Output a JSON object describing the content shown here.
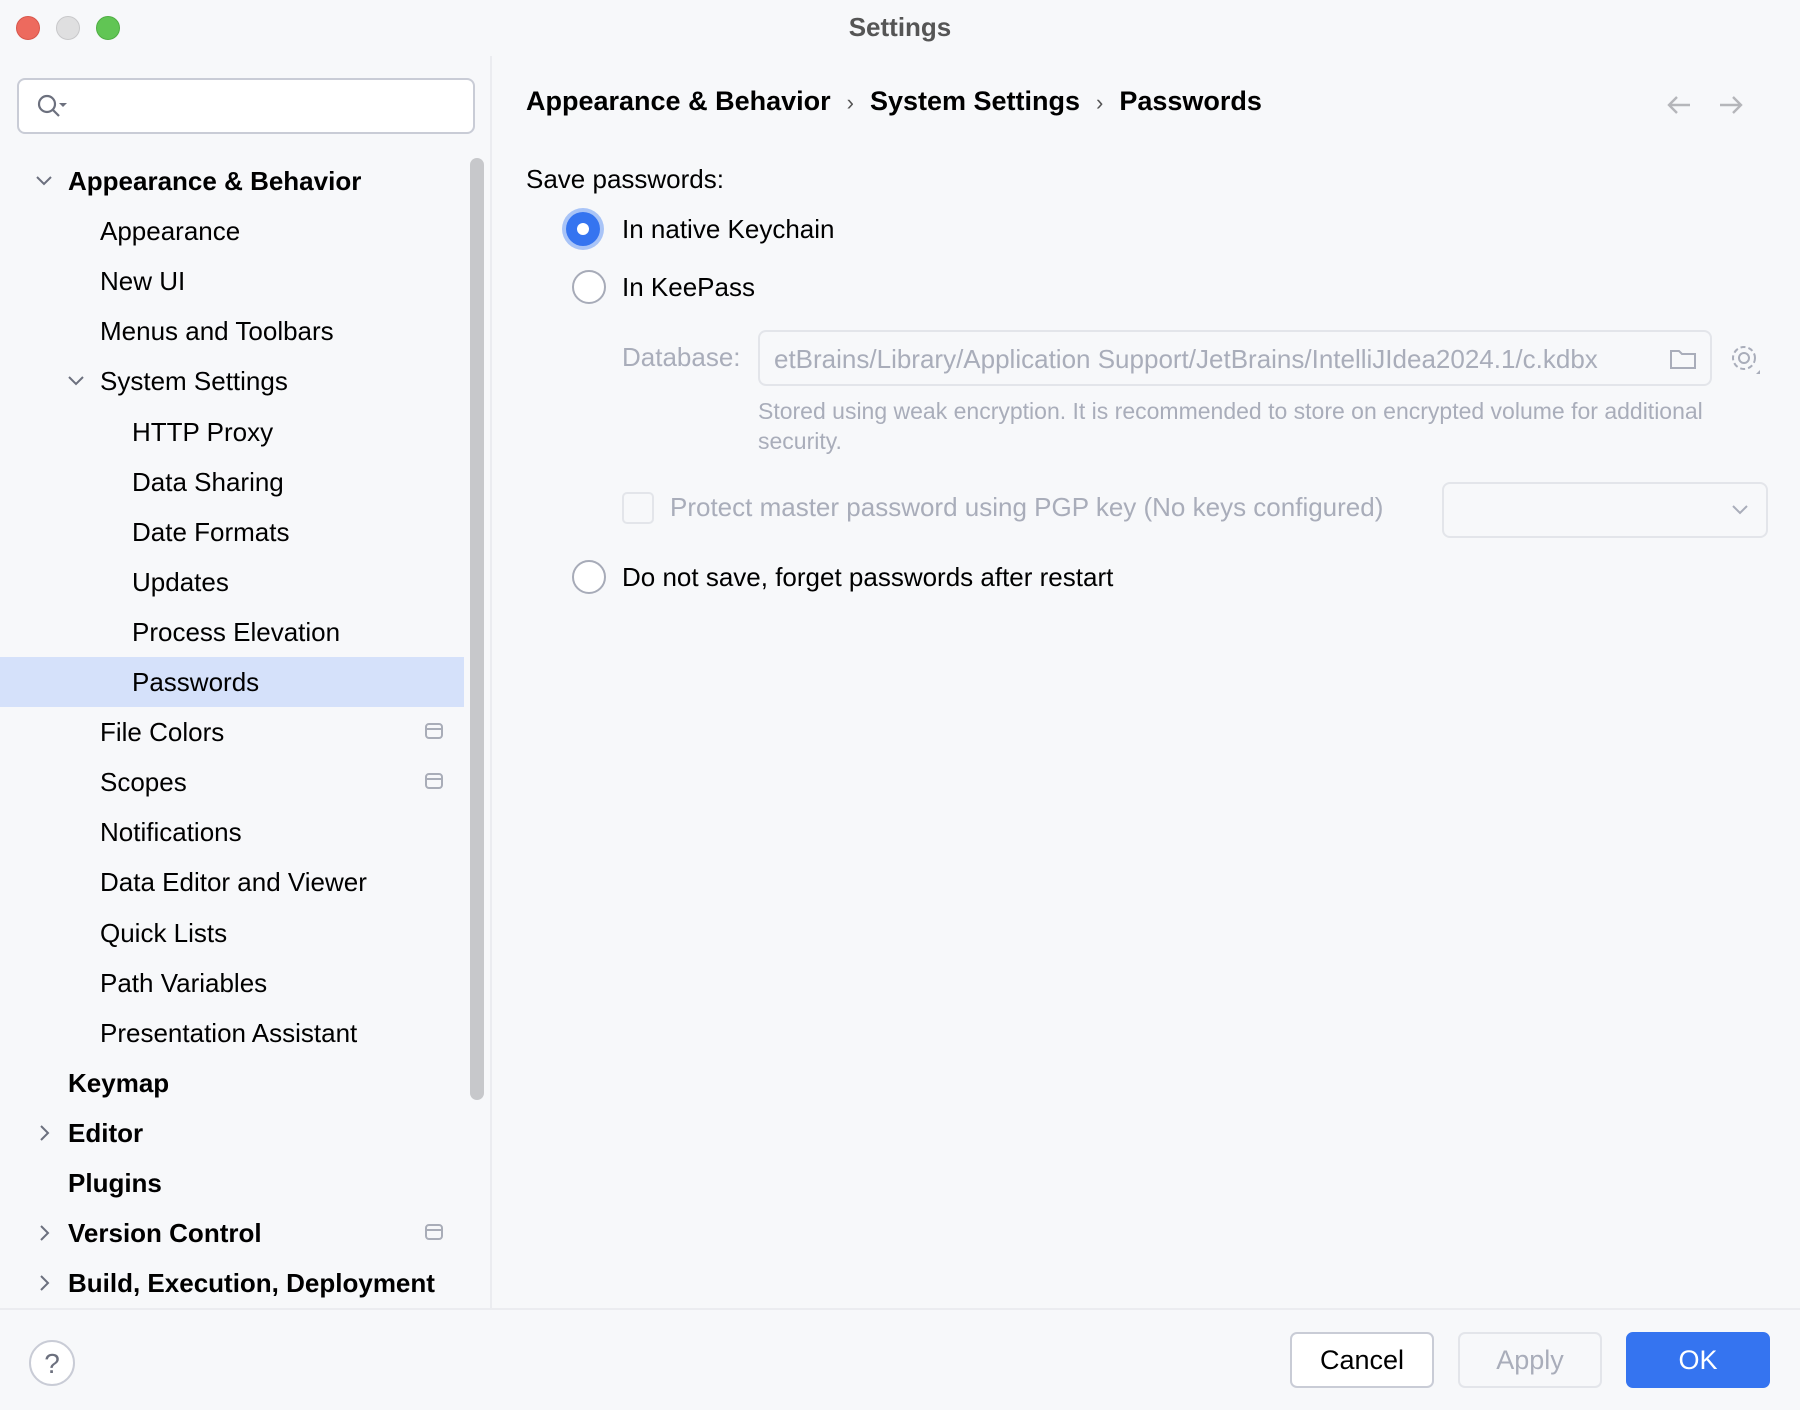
{
  "window": {
    "title": "Settings"
  },
  "search": {
    "placeholder": "",
    "value": ""
  },
  "sidebar": {
    "items": [
      {
        "label": "Appearance & Behavior",
        "level": 0,
        "bold": true,
        "expanded": true
      },
      {
        "label": "Appearance",
        "level": 1
      },
      {
        "label": "New UI",
        "level": 1
      },
      {
        "label": "Menus and Toolbars",
        "level": 1
      },
      {
        "label": "System Settings",
        "level": 1,
        "expanded": true
      },
      {
        "label": "HTTP Proxy",
        "level": 2
      },
      {
        "label": "Data Sharing",
        "level": 2
      },
      {
        "label": "Date Formats",
        "level": 2
      },
      {
        "label": "Updates",
        "level": 2
      },
      {
        "label": "Process Elevation",
        "level": 2
      },
      {
        "label": "Passwords",
        "level": 2,
        "selected": true
      },
      {
        "label": "File Colors",
        "level": 1,
        "badge": true
      },
      {
        "label": "Scopes",
        "level": 1,
        "badge": true
      },
      {
        "label": "Notifications",
        "level": 1
      },
      {
        "label": "Data Editor and Viewer",
        "level": 1
      },
      {
        "label": "Quick Lists",
        "level": 1
      },
      {
        "label": "Path Variables",
        "level": 1
      },
      {
        "label": "Presentation Assistant",
        "level": 1
      },
      {
        "label": "Keymap",
        "level": 0,
        "bold": true
      },
      {
        "label": "Editor",
        "level": 0,
        "bold": true,
        "collapsed": true
      },
      {
        "label": "Plugins",
        "level": 0,
        "bold": true
      },
      {
        "label": "Version Control",
        "level": 0,
        "bold": true,
        "collapsed": true,
        "badge": true
      },
      {
        "label": "Build, Execution, Deployment",
        "level": 0,
        "bold": true,
        "collapsed": true
      }
    ]
  },
  "breadcrumb": [
    "Appearance & Behavior",
    "System Settings",
    "Passwords"
  ],
  "passwords": {
    "save_label": "Save passwords:",
    "options": {
      "keychain": "In native Keychain",
      "keepass": "In KeePass",
      "none": "Do not save, forget passwords after restart"
    },
    "selected": "keychain",
    "database_label": "Database:",
    "database_value": "etBrains/Library/Application Support/JetBrains/IntelliJIdea2024.1/c.kdbx",
    "hint": "Stored using weak encryption. It is recommended to store on encrypted volume for additional security.",
    "pgp_label": "Protect master password using PGP key (No keys configured)",
    "pgp_checked": false,
    "pgp_select_value": ""
  },
  "footer": {
    "help": "?",
    "cancel": "Cancel",
    "apply": "Apply",
    "ok": "OK"
  },
  "colors": {
    "accent": "#3574f0",
    "selection": "#d5e1fa",
    "disabled_text": "#a9adba"
  }
}
